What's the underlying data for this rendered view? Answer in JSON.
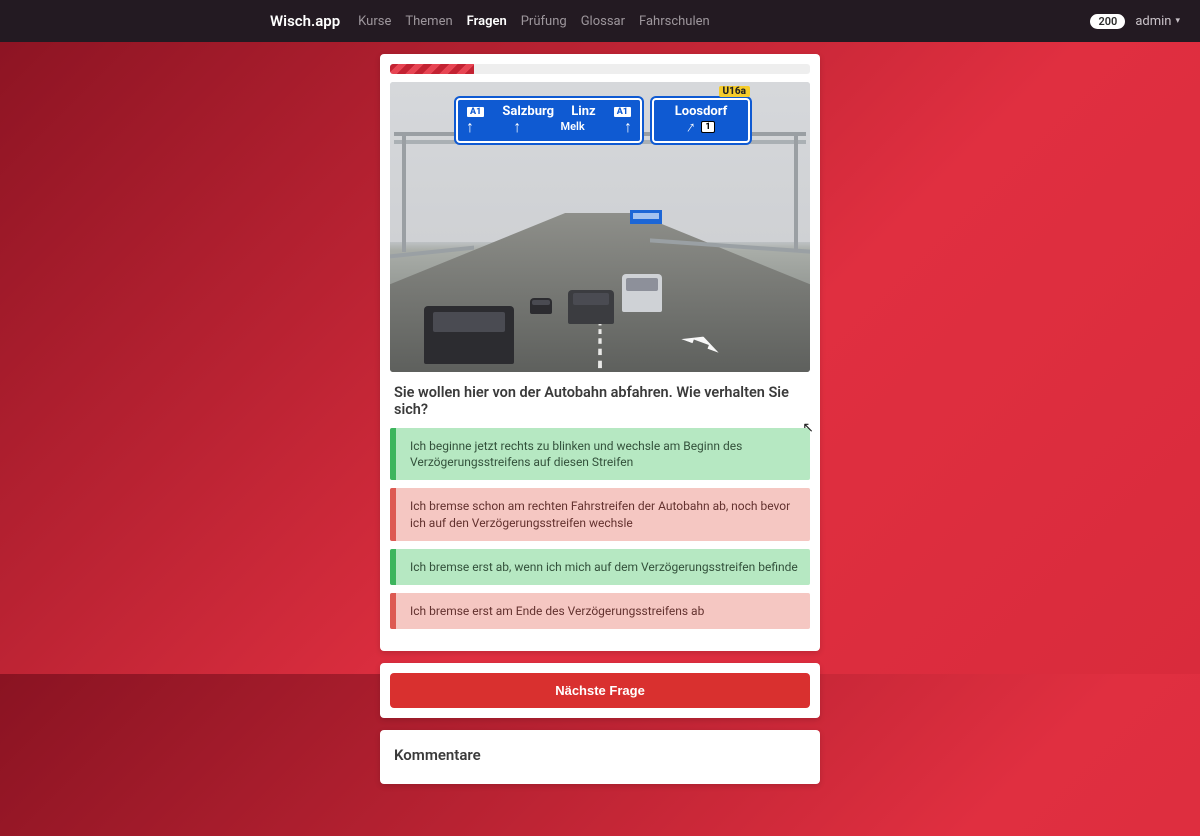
{
  "nav": {
    "brand": "Wisch.app",
    "links": [
      "Kurse",
      "Themen",
      "Fragen",
      "Prüfung",
      "Glossar",
      "Fahrschulen"
    ],
    "active_index": 2,
    "badge": "200",
    "user": "admin"
  },
  "progress_percent": 20,
  "scene": {
    "sign_left_route_badge_1": "A1",
    "sign_left_city_1": "Salzburg",
    "sign_left_city_2": "Linz",
    "sign_left_route_badge_2": "A1",
    "sign_left_sub": "Melk",
    "sign_right_exit_num": "U16a",
    "sign_right_city": "Loosdorf",
    "sign_right_exit_road": "1"
  },
  "question": "Sie wollen hier von der Autobahn abfahren. Wie verhalten Sie sich?",
  "answers": [
    {
      "text": "Ich beginne jetzt rechts zu blinken und wechsle am Beginn des Verzögerungsstreifens auf diesen Streifen",
      "state": "correct"
    },
    {
      "text": "Ich bremse schon am rechten Fahrstreifen der Autobahn ab, noch bevor ich auf den Verzögerungsstreifen wechsle",
      "state": "wrong"
    },
    {
      "text": "Ich bremse erst ab, wenn ich mich auf dem Verzögerungsstreifen befinde",
      "state": "correct"
    },
    {
      "text": "Ich bremse erst am Ende des Verzögerungsstreifens ab",
      "state": "wrong"
    }
  ],
  "next_button": "Nächste Frage",
  "comments_title": "Kommentare"
}
